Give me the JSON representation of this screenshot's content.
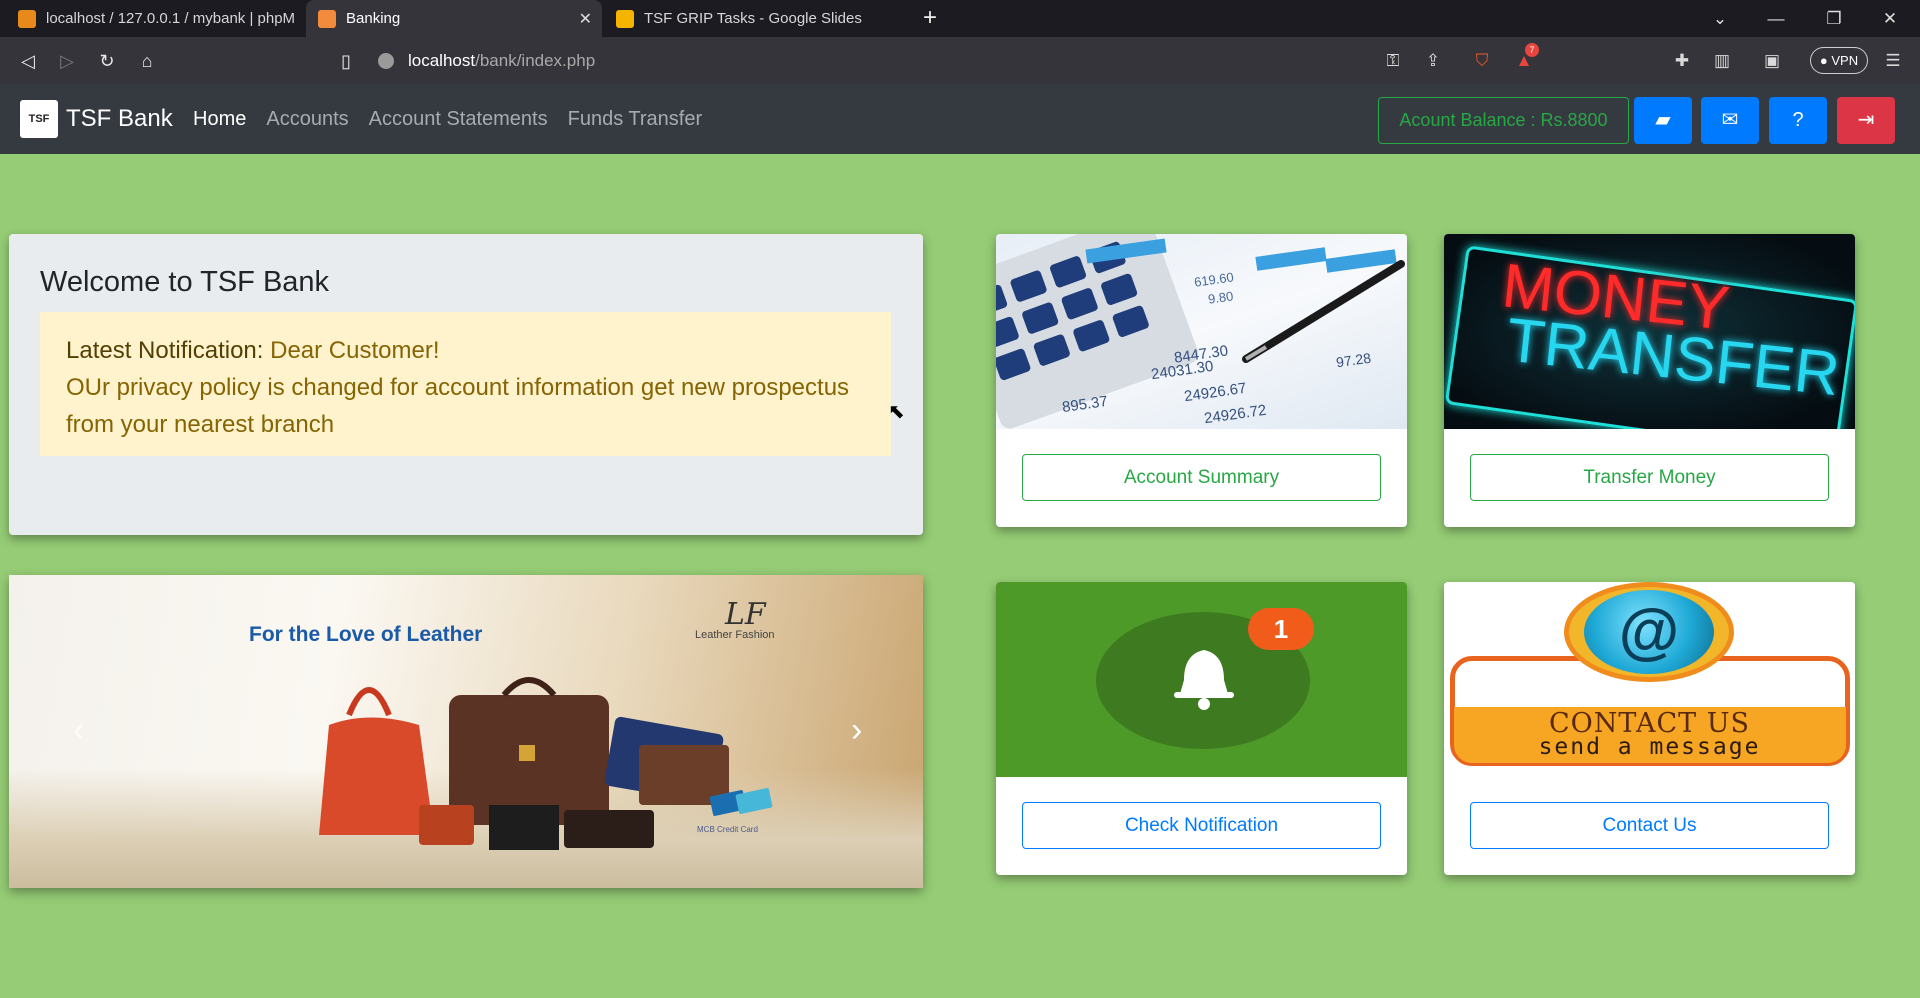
{
  "browser": {
    "tabs": [
      {
        "title": "localhost / 127.0.0.1 / mybank | phpM"
      },
      {
        "title": "Banking"
      },
      {
        "title": "TSF GRIP Tasks - Google Slides"
      }
    ],
    "url_host": "localhost",
    "url_path": "/bank/index.php",
    "vpn_label": "VPN",
    "notification_count": "7"
  },
  "navbar": {
    "brand": "TSF Bank",
    "logo_text": "TSF",
    "links": [
      "Home",
      "Accounts",
      "Account Statements",
      "Funds Transfer"
    ],
    "balance": "Acount Balance : Rs.8800"
  },
  "welcome": {
    "title": "Welcome to TSF Bank",
    "notification_label": "Latest Notification:",
    "notification_greeting": "Dear Customer!",
    "notification_body": "OUr privacy policy is changed for account information get new prospectus from your nearest branch"
  },
  "carousel": {
    "headline": "For the Love of Leather",
    "logo": "LF",
    "logo_sub": "Leather Fashion",
    "card_caption": "MCB Credit Card"
  },
  "cards": {
    "summary_btn": "Account Summary",
    "transfer_btn": "Transfer Money",
    "notification_btn": "Check Notification",
    "contact_btn": "Contact Us",
    "transfer_img_line1": "MONEY",
    "transfer_img_line2": "TRANSFER",
    "bell_badge": "1",
    "contact_img_line1": "CONTACT US",
    "contact_img_line2": "send a message",
    "calc_numbers": [
      "619.60",
      "9.80",
      "24031.30",
      "24926.67",
      "895.37",
      "24926.72",
      "97.28",
      "8447.30"
    ]
  },
  "colors": {
    "page_bg": "#95cc75",
    "navbar_bg": "#343a40",
    "success": "#28a745",
    "primary": "#007bff",
    "danger": "#dc3545"
  }
}
